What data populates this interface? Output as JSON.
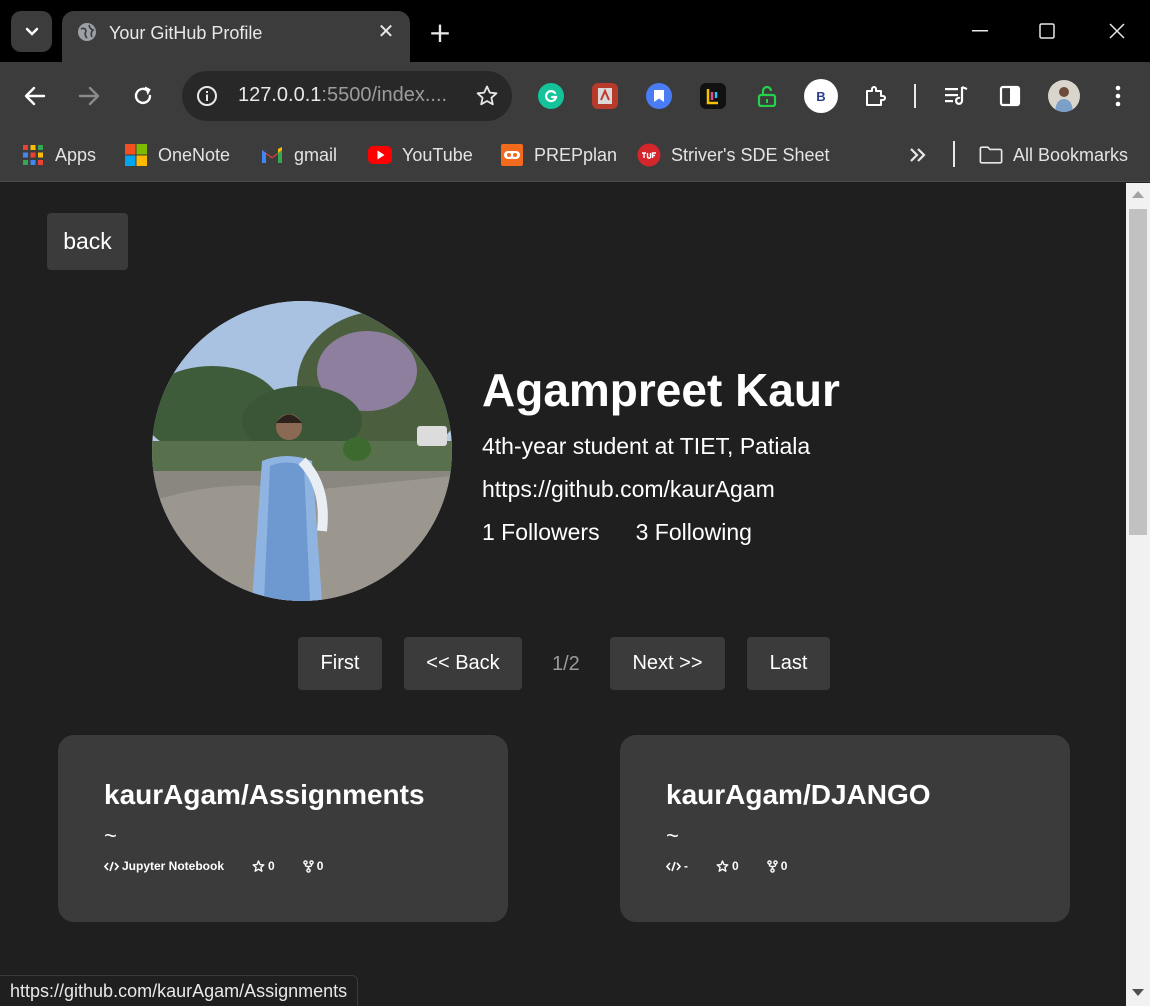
{
  "browser": {
    "tab_title": "Your GitHub Profile",
    "url_host": "127.0.0.1",
    "url_rest": ":5500/index....",
    "profile_initial": "B",
    "status_url": "https://github.com/kaurAgam/Assignments"
  },
  "bookmarks": [
    {
      "label": "Apps",
      "icon": "apps-grid-icon"
    },
    {
      "label": "OneNote",
      "icon": "microsoft-logo-icon"
    },
    {
      "label": "gmail",
      "icon": "gmail-icon"
    },
    {
      "label": "YouTube",
      "icon": "youtube-icon"
    },
    {
      "label": "PREPplan",
      "icon": "prepplan-icon"
    },
    {
      "label": "Striver's SDE Sheet",
      "icon": "tuf-icon"
    }
  ],
  "all_bookmarks_label": "All Bookmarks",
  "page": {
    "back_label": "back",
    "profile": {
      "name": "Agampreet Kaur",
      "bio": "4th-year student at TIET, Patiala",
      "url": "https://github.com/kaurAgam",
      "followers": "1 Followers",
      "following": "3 Following"
    },
    "pager": {
      "first": "First",
      "back": "<< Back",
      "indicator": "1/2",
      "next": "Next >>",
      "last": "Last"
    },
    "repos": [
      {
        "title": "kaurAgam/Assignments",
        "description": "~",
        "language": "Jupyter Notebook",
        "stars": "0",
        "forks": "0"
      },
      {
        "title": "kaurAgam/DJANGO",
        "description": "~",
        "language": "-",
        "stars": "0",
        "forks": "0"
      }
    ]
  },
  "colors": {
    "page_bg": "#1f1f1f",
    "card_bg": "#3b3b3b",
    "chrome_bg": "#3c3c3c"
  }
}
